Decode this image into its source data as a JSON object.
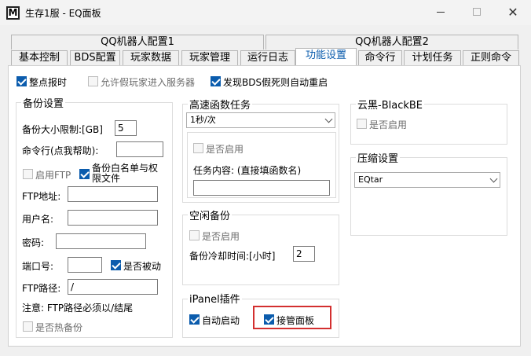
{
  "window": {
    "title": "生存1服 - EQ面板",
    "app_icon_letter": "M"
  },
  "tab_groups": [
    "QQ机器人配置1",
    "QQ机器人配置2"
  ],
  "tabs": [
    "基本控制",
    "BDS配置",
    "玩家数据",
    "玩家管理",
    "运行日志",
    "功能设置",
    "命令行",
    "计划任务",
    "正则命令"
  ],
  "active_tab": "功能设置",
  "top_options": {
    "punctual": "整点报时",
    "fake_player": "允许假玩家进入服务器",
    "bds_restart": "发现BDS假死则自动重启"
  },
  "backup": {
    "title": "备份设置",
    "size_limit_label": "备份大小限制:[GB]",
    "size_limit_value": "5",
    "cmd_label": "命令行(点我帮助):",
    "cmd_value": "",
    "ftp_enable": "启用FTP",
    "whitelist_line1": "备份白名单与权",
    "whitelist_line2": "限文件",
    "ftp_addr_label": "FTP地址:",
    "user_label": "用户名:",
    "pass_label": "密码:",
    "port_label": "端口号:",
    "passive": "是否被动",
    "ftp_path_label": "FTP路径:",
    "ftp_path_value": "/",
    "note": "注意: FTP路径必须以/结尾",
    "hot_backup": "是否热备份"
  },
  "fast_func": {
    "title": "高速函数任务",
    "interval_value": "1秒/次",
    "enable": "是否启用",
    "content_label": "任务内容: (直接填函数名)",
    "content_value": ""
  },
  "idle_backup": {
    "title": "空闲备份",
    "enable": "是否启用",
    "cooldown_label": "备份冷却时间:[小时]",
    "cooldown_value": "2"
  },
  "ipanel": {
    "title": "iPanel插件",
    "autostart": "自动启动",
    "takeover": "接管面板"
  },
  "blackbe": {
    "title": "云黑-BlackBE",
    "enable": "是否启用"
  },
  "compress": {
    "title": "压缩设置",
    "selected": "EQtar"
  },
  "colors": {
    "accent": "#0b5cad",
    "highlight": "#d32f2f"
  }
}
